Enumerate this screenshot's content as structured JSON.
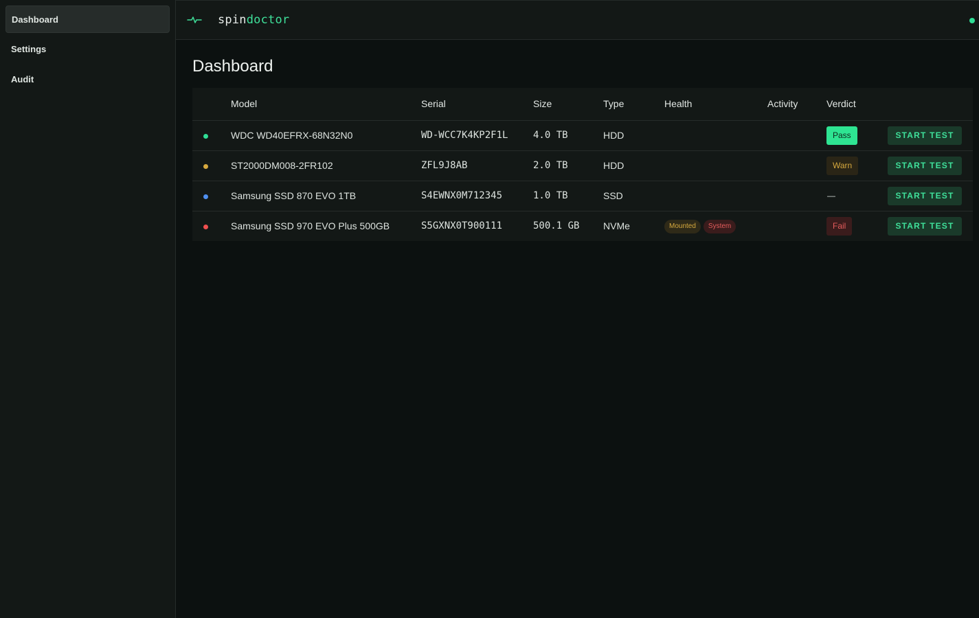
{
  "sidebar": {
    "items": [
      {
        "label": "Dashboard",
        "active": true
      },
      {
        "label": "Settings",
        "active": false
      },
      {
        "label": "Audit",
        "active": false
      }
    ]
  },
  "topbar": {
    "brand_part1": "spin",
    "brand_part2": "doctor",
    "logo_icon": "pulse-icon",
    "status_color": "#2fdd95"
  },
  "main": {
    "title": "Dashboard",
    "table": {
      "headers": [
        "",
        "Model",
        "Serial",
        "Size",
        "Type",
        "Health",
        "Activity",
        "Verdict",
        ""
      ],
      "action_label": "START TEST",
      "rows": [
        {
          "dot_color": "#2fdd95",
          "model": "WDC WD40EFRX-68N32N0",
          "serial": "WD-WCC7K4KP2F1L",
          "size": "4.0 TB",
          "type": "HDD",
          "chips": [],
          "activity": "",
          "verdict": "Pass",
          "verdict_kind": "pass"
        },
        {
          "dot_color": "#d6a93e",
          "model": "ST2000DM008-2FR102",
          "serial": "ZFL9J8AB",
          "size": "2.0 TB",
          "type": "HDD",
          "chips": [],
          "activity": "",
          "verdict": "Warn",
          "verdict_kind": "warn"
        },
        {
          "dot_color": "#4f8ff0",
          "model": "Samsung SSD 870 EVO 1TB",
          "serial": "S4EWNX0M712345",
          "size": "1.0 TB",
          "type": "SSD",
          "chips": [],
          "activity": "",
          "verdict": "—",
          "verdict_kind": "none"
        },
        {
          "dot_color": "#ef4f4f",
          "model": "Samsung SSD 970 EVO Plus 500GB",
          "serial": "S5GXNX0T900111",
          "size": "500.1 GB",
          "type": "NVMe",
          "chips": [
            {
              "label": "Mounted",
              "kind": "mounted"
            },
            {
              "label": "System",
              "kind": "system"
            }
          ],
          "activity": "",
          "verdict": "Fail",
          "verdict_kind": "fail"
        }
      ]
    }
  }
}
